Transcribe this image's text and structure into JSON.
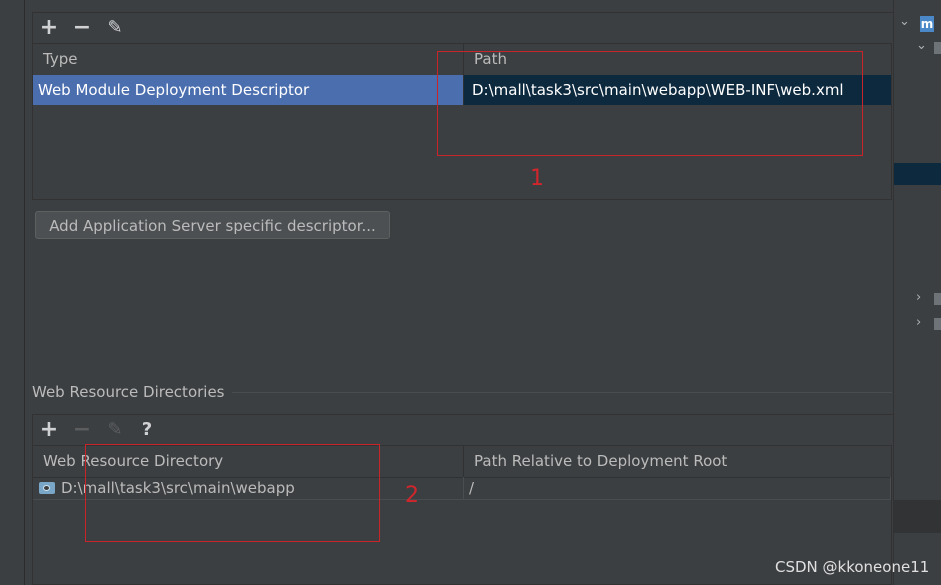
{
  "descriptors_toolbar": {
    "add": "+",
    "remove": "−",
    "edit": "✎"
  },
  "descriptors_table": {
    "columns": [
      "Type",
      "Path"
    ],
    "rows": [
      {
        "type": "Web Module Deployment Descriptor",
        "path": "D:\\mall\\task3\\src\\main\\webapp\\WEB-INF\\web.xml"
      }
    ]
  },
  "add_server_descriptor_button": "Add Application Server specific descriptor...",
  "web_resource_section": {
    "title": "Web Resource Directories",
    "toolbar": {
      "add": "+",
      "remove": "−",
      "edit": "✎",
      "help": "?"
    },
    "columns": [
      "Web Resource Directory",
      "Path Relative to Deployment Root"
    ],
    "rows": [
      {
        "directory": "D:\\mall\\task3\\src\\main\\webapp",
        "relative_path": "/"
      }
    ]
  },
  "annotations": {
    "label_1": "1",
    "label_2": "2"
  },
  "right_panel": {
    "module_badge": "m"
  },
  "watermark": "CSDN @kkoneone11",
  "colors": {
    "background": "#3c3f41",
    "selection": "#4b6eaf",
    "selected_cell": "#0d293e",
    "annotation_red": "#c8242a"
  }
}
